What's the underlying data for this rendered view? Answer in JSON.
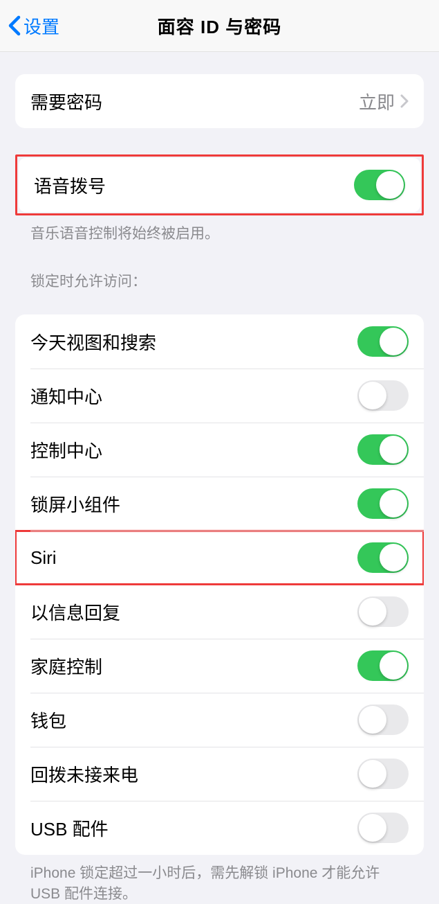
{
  "header": {
    "back_label": "设置",
    "title": "面容 ID 与密码"
  },
  "group_passcode": {
    "require_label": "需要密码",
    "require_value": "立即"
  },
  "group_voice": {
    "voice_dial_label": "语音拨号",
    "voice_dial_on": true,
    "footer": "音乐语音控制将始终被启用。"
  },
  "locked_access": {
    "header": "锁定时允许访问：",
    "items": [
      {
        "label": "今天视图和搜索",
        "on": true,
        "highlight": false
      },
      {
        "label": "通知中心",
        "on": false,
        "highlight": false
      },
      {
        "label": "控制中心",
        "on": true,
        "highlight": false
      },
      {
        "label": "锁屏小组件",
        "on": true,
        "highlight": false
      },
      {
        "label": "Siri",
        "on": true,
        "highlight": true
      },
      {
        "label": "以信息回复",
        "on": false,
        "highlight": false
      },
      {
        "label": "家庭控制",
        "on": true,
        "highlight": false
      },
      {
        "label": "钱包",
        "on": false,
        "highlight": false
      },
      {
        "label": "回拨未接来电",
        "on": false,
        "highlight": false
      },
      {
        "label": "USB 配件",
        "on": false,
        "highlight": false
      }
    ],
    "footer": "iPhone 锁定超过一小时后，需先解锁 iPhone 才能允许 USB 配件连接。"
  }
}
